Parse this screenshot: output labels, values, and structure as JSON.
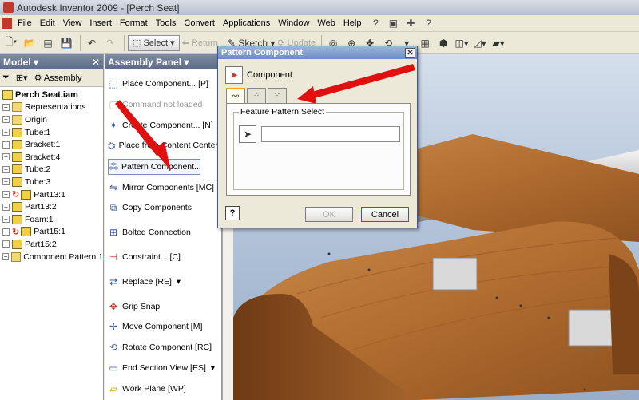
{
  "window": {
    "title": "Autodesk Inventor 2009 - [Perch Seat]"
  },
  "menu": [
    "File",
    "Edit",
    "View",
    "Insert",
    "Format",
    "Tools",
    "Convert",
    "Applications",
    "Window",
    "Web",
    "Help"
  ],
  "toolbar": {
    "select": "Select",
    "return": "Return",
    "sketch": "Sketch",
    "update": "Update"
  },
  "model_panel": {
    "title": "Model",
    "assembly_label": "Assembly",
    "root": "Perch Seat.iam",
    "items": [
      "Representations",
      "Origin",
      "Tube:1",
      "Bracket:1",
      "Bracket:4",
      "Tube:2",
      "Tube:3",
      "Part13:1",
      "Part13:2",
      "Foam:1",
      "Part15:1",
      "Part15:2",
      "Component Pattern 1"
    ]
  },
  "assembly_panel": {
    "title": "Assembly Panel",
    "items": [
      {
        "label": "Place Component...  [P]"
      },
      {
        "label": "Command not loaded"
      },
      {
        "label": "Create Component...  [N]"
      },
      {
        "label": "Place from Content Center..."
      },
      {
        "label": "Pattern Component..."
      },
      {
        "label": "Mirror Components    [MC]"
      },
      {
        "label": "Copy Components"
      },
      {
        "label": "Bolted Connection"
      },
      {
        "label": "Constraint...    [C]"
      },
      {
        "label": "Replace    [RE]"
      },
      {
        "label": "Grip Snap"
      },
      {
        "label": "Move Component    [M]"
      },
      {
        "label": "Rotate Component    [RC]"
      },
      {
        "label": "End Section View    [ES]"
      },
      {
        "label": "Work Plane    [WP]"
      }
    ]
  },
  "dialog": {
    "title": "Pattern Component",
    "component_label": "Component",
    "group_label": "Feature Pattern Select",
    "ok": "OK",
    "cancel": "Cancel",
    "help": "?"
  },
  "colors": {
    "annotation_arrow": "#e01010",
    "wood": "#b06a2c",
    "rail": "#c8c8c8"
  }
}
